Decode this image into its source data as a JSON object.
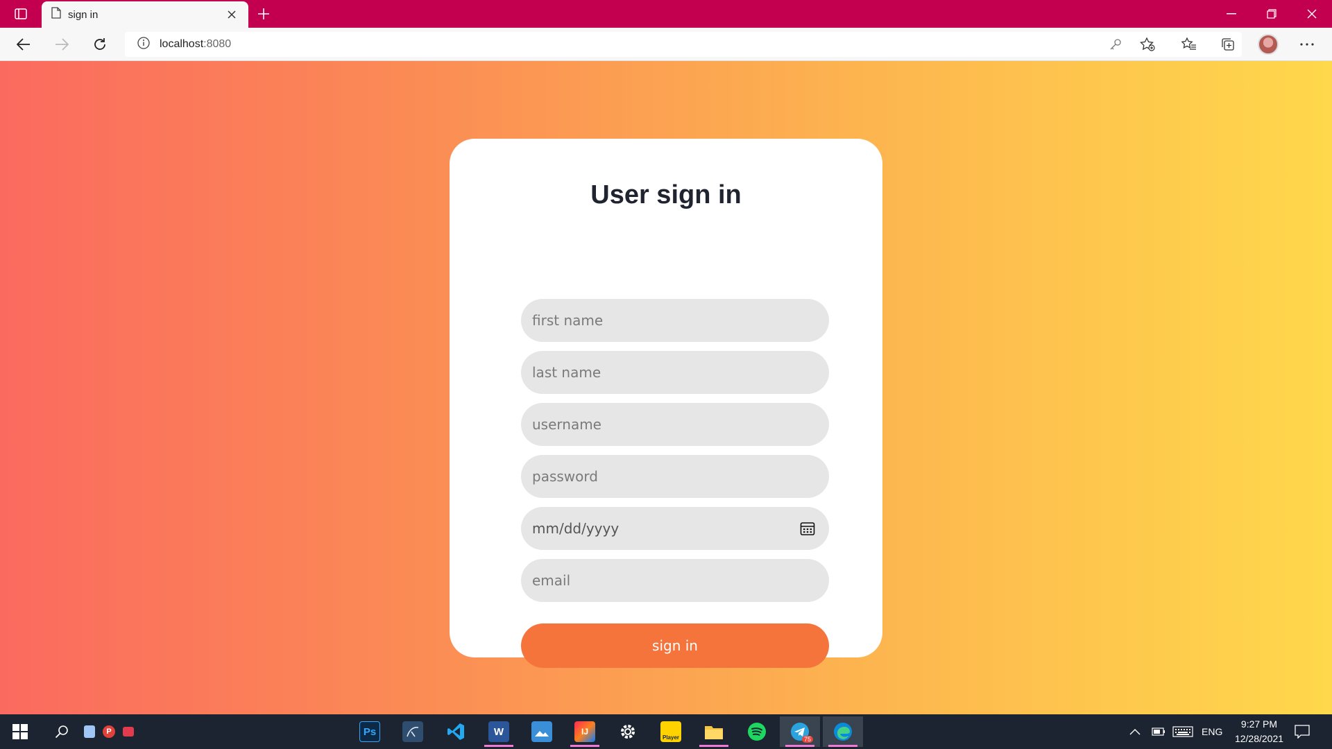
{
  "browser": {
    "tab_title": "sign in",
    "url_host": "localhost",
    "url_port": ":8080",
    "theme_color": "#c3004f"
  },
  "form": {
    "title": "User sign in",
    "fields": [
      {
        "name": "first-name-input",
        "placeholder": "first name"
      },
      {
        "name": "last-name-input",
        "placeholder": "last name"
      },
      {
        "name": "username-input",
        "placeholder": "username"
      },
      {
        "name": "password-input",
        "placeholder": "password"
      },
      {
        "name": "date-input",
        "placeholder": "mm/dd/yyyy"
      },
      {
        "name": "email-input",
        "placeholder": "email"
      }
    ],
    "submit_label": "sign in",
    "accent": "#f5743c"
  },
  "taskbar": {
    "apps": [
      "Ps",
      "Player"
    ],
    "telegram_badge": "75",
    "language": "ENG",
    "time": "9:27 PM",
    "date": "12/28/2021"
  }
}
